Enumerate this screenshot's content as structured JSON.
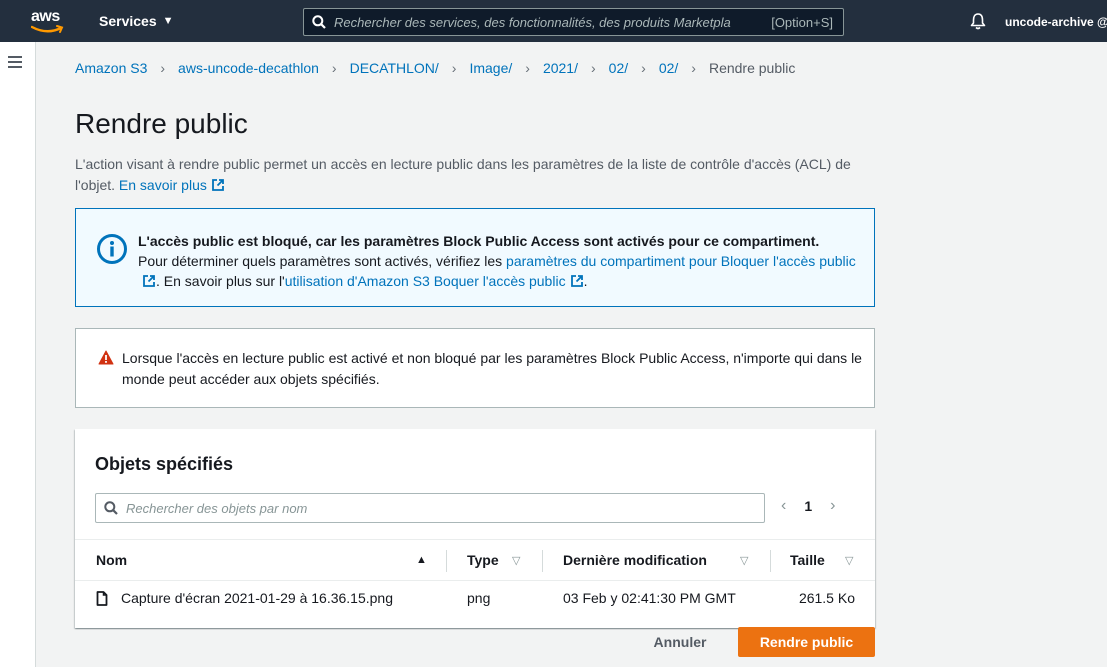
{
  "topnav": {
    "logo_text": "aws",
    "services_label": "Services",
    "search_placeholder": "Rechercher des services, des fonctionnalités, des produits Marketpla",
    "search_shortcut": "[Option+S]",
    "account_label": "uncode-archive @"
  },
  "breadcrumb": {
    "items": [
      "Amazon S3",
      "aws-uncode-decathlon",
      "DECATHLON/",
      "Image/",
      "2021/",
      "02/",
      "02/"
    ],
    "current": "Rendre public"
  },
  "page": {
    "title": "Rendre public",
    "description": "L'action visant à rendre public permet un accès en lecture public dans les paramètres de la liste de contrôle d'accès (ACL) de l'objet.",
    "learn_more": "En savoir plus"
  },
  "info": {
    "heading": "L'accès public est bloqué, car les paramètres Block Public Access sont activés pour ce compartiment.",
    "text_prefix": "Pour déterminer quels paramètres sont activés, vérifiez les ",
    "link1": "paramètres du compartiment pour Bloquer l'accès public",
    "text_middle": ". En savoir plus sur l'",
    "link2": "utilisation d'Amazon S3 Boquer l'accès public",
    "text_suffix": "."
  },
  "warning": {
    "text": "Lorsque l'accès en lecture public est activé et non bloqué par les paramètres Block Public Access, n'importe qui dans le monde peut accéder aux objets spécifiés."
  },
  "objects": {
    "title": "Objets spécifiés",
    "search_placeholder": "Rechercher des objets par nom",
    "page_number": "1",
    "columns": {
      "name": "Nom",
      "type": "Type",
      "modified": "Dernière modification",
      "size": "Taille"
    },
    "rows": [
      {
        "name": "Capture d'écran 2021-01-29 à 16.36.15.png",
        "type": "png",
        "modified": "03 Feb y 02:41:30 PM GMT",
        "size": "261.5 Ko"
      }
    ]
  },
  "actions": {
    "cancel_label": "Annuler",
    "submit_label": "Rendre public"
  },
  "colors": {
    "nav_bg": "#232f3e",
    "link": "#0073bb",
    "primary_button": "#ec7211",
    "info_bg": "#f1faff",
    "warning_icon": "#d13212"
  }
}
